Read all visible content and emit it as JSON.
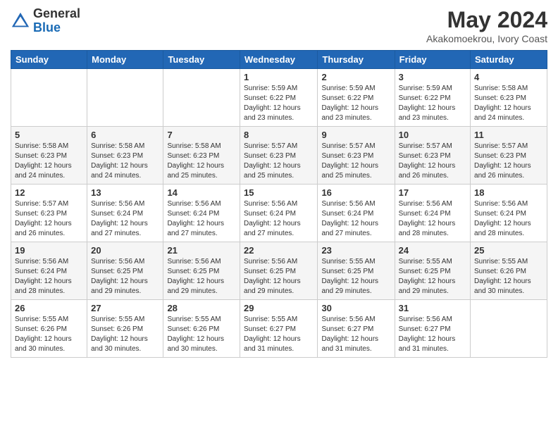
{
  "header": {
    "logo": {
      "general": "General",
      "blue": "Blue"
    },
    "title": "May 2024",
    "location": "Akakomoekrou, Ivory Coast"
  },
  "calendar": {
    "days_of_week": [
      "Sunday",
      "Monday",
      "Tuesday",
      "Wednesday",
      "Thursday",
      "Friday",
      "Saturday"
    ],
    "weeks": [
      [
        {
          "day": "",
          "info": ""
        },
        {
          "day": "",
          "info": ""
        },
        {
          "day": "",
          "info": ""
        },
        {
          "day": "1",
          "info": "Sunrise: 5:59 AM\nSunset: 6:22 PM\nDaylight: 12 hours\nand 23 minutes."
        },
        {
          "day": "2",
          "info": "Sunrise: 5:59 AM\nSunset: 6:22 PM\nDaylight: 12 hours\nand 23 minutes."
        },
        {
          "day": "3",
          "info": "Sunrise: 5:59 AM\nSunset: 6:22 PM\nDaylight: 12 hours\nand 23 minutes."
        },
        {
          "day": "4",
          "info": "Sunrise: 5:58 AM\nSunset: 6:23 PM\nDaylight: 12 hours\nand 24 minutes."
        }
      ],
      [
        {
          "day": "5",
          "info": "Sunrise: 5:58 AM\nSunset: 6:23 PM\nDaylight: 12 hours\nand 24 minutes."
        },
        {
          "day": "6",
          "info": "Sunrise: 5:58 AM\nSunset: 6:23 PM\nDaylight: 12 hours\nand 24 minutes."
        },
        {
          "day": "7",
          "info": "Sunrise: 5:58 AM\nSunset: 6:23 PM\nDaylight: 12 hours\nand 25 minutes."
        },
        {
          "day": "8",
          "info": "Sunrise: 5:57 AM\nSunset: 6:23 PM\nDaylight: 12 hours\nand 25 minutes."
        },
        {
          "day": "9",
          "info": "Sunrise: 5:57 AM\nSunset: 6:23 PM\nDaylight: 12 hours\nand 25 minutes."
        },
        {
          "day": "10",
          "info": "Sunrise: 5:57 AM\nSunset: 6:23 PM\nDaylight: 12 hours\nand 26 minutes."
        },
        {
          "day": "11",
          "info": "Sunrise: 5:57 AM\nSunset: 6:23 PM\nDaylight: 12 hours\nand 26 minutes."
        }
      ],
      [
        {
          "day": "12",
          "info": "Sunrise: 5:57 AM\nSunset: 6:23 PM\nDaylight: 12 hours\nand 26 minutes."
        },
        {
          "day": "13",
          "info": "Sunrise: 5:56 AM\nSunset: 6:24 PM\nDaylight: 12 hours\nand 27 minutes."
        },
        {
          "day": "14",
          "info": "Sunrise: 5:56 AM\nSunset: 6:24 PM\nDaylight: 12 hours\nand 27 minutes."
        },
        {
          "day": "15",
          "info": "Sunrise: 5:56 AM\nSunset: 6:24 PM\nDaylight: 12 hours\nand 27 minutes."
        },
        {
          "day": "16",
          "info": "Sunrise: 5:56 AM\nSunset: 6:24 PM\nDaylight: 12 hours\nand 27 minutes."
        },
        {
          "day": "17",
          "info": "Sunrise: 5:56 AM\nSunset: 6:24 PM\nDaylight: 12 hours\nand 28 minutes."
        },
        {
          "day": "18",
          "info": "Sunrise: 5:56 AM\nSunset: 6:24 PM\nDaylight: 12 hours\nand 28 minutes."
        }
      ],
      [
        {
          "day": "19",
          "info": "Sunrise: 5:56 AM\nSunset: 6:24 PM\nDaylight: 12 hours\nand 28 minutes."
        },
        {
          "day": "20",
          "info": "Sunrise: 5:56 AM\nSunset: 6:25 PM\nDaylight: 12 hours\nand 29 minutes."
        },
        {
          "day": "21",
          "info": "Sunrise: 5:56 AM\nSunset: 6:25 PM\nDaylight: 12 hours\nand 29 minutes."
        },
        {
          "day": "22",
          "info": "Sunrise: 5:56 AM\nSunset: 6:25 PM\nDaylight: 12 hours\nand 29 minutes."
        },
        {
          "day": "23",
          "info": "Sunrise: 5:55 AM\nSunset: 6:25 PM\nDaylight: 12 hours\nand 29 minutes."
        },
        {
          "day": "24",
          "info": "Sunrise: 5:55 AM\nSunset: 6:25 PM\nDaylight: 12 hours\nand 29 minutes."
        },
        {
          "day": "25",
          "info": "Sunrise: 5:55 AM\nSunset: 6:26 PM\nDaylight: 12 hours\nand 30 minutes."
        }
      ],
      [
        {
          "day": "26",
          "info": "Sunrise: 5:55 AM\nSunset: 6:26 PM\nDaylight: 12 hours\nand 30 minutes."
        },
        {
          "day": "27",
          "info": "Sunrise: 5:55 AM\nSunset: 6:26 PM\nDaylight: 12 hours\nand 30 minutes."
        },
        {
          "day": "28",
          "info": "Sunrise: 5:55 AM\nSunset: 6:26 PM\nDaylight: 12 hours\nand 30 minutes."
        },
        {
          "day": "29",
          "info": "Sunrise: 5:55 AM\nSunset: 6:27 PM\nDaylight: 12 hours\nand 31 minutes."
        },
        {
          "day": "30",
          "info": "Sunrise: 5:56 AM\nSunset: 6:27 PM\nDaylight: 12 hours\nand 31 minutes."
        },
        {
          "day": "31",
          "info": "Sunrise: 5:56 AM\nSunset: 6:27 PM\nDaylight: 12 hours\nand 31 minutes."
        },
        {
          "day": "",
          "info": ""
        }
      ]
    ]
  }
}
